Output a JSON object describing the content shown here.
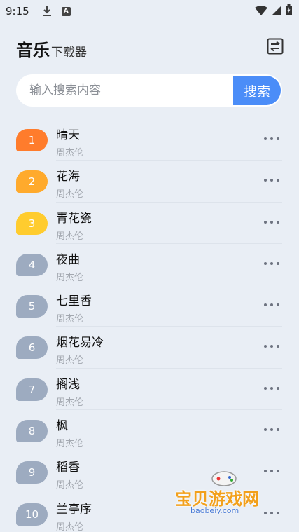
{
  "status_bar": {
    "time": "9:15",
    "a_label": "A"
  },
  "header": {
    "title": "音乐",
    "subtitle": "下载器"
  },
  "search": {
    "placeholder": "输入搜索内容",
    "button_label": "搜索",
    "button_color": "#4b8df8"
  },
  "songs": [
    {
      "rank": "1",
      "title": "晴天",
      "artist": "周杰伦",
      "badge_color": "#ff7c2c"
    },
    {
      "rank": "2",
      "title": "花海",
      "artist": "周杰伦",
      "badge_color": "#ffaa2c"
    },
    {
      "rank": "3",
      "title": "青花瓷",
      "artist": "周杰伦",
      "badge_color": "#ffcc2e"
    },
    {
      "rank": "4",
      "title": "夜曲",
      "artist": "周杰伦",
      "badge_color": "#9dabc0"
    },
    {
      "rank": "5",
      "title": "七里香",
      "artist": "周杰伦",
      "badge_color": "#9dabc0"
    },
    {
      "rank": "6",
      "title": "烟花易冷",
      "artist": "周杰伦",
      "badge_color": "#9dabc0"
    },
    {
      "rank": "7",
      "title": "搁浅",
      "artist": "周杰伦",
      "badge_color": "#9dabc0"
    },
    {
      "rank": "8",
      "title": "枫",
      "artist": "周杰伦",
      "badge_color": "#9dabc0"
    },
    {
      "rank": "9",
      "title": "稻香",
      "artist": "周杰伦",
      "badge_color": "#9dabc0"
    },
    {
      "rank": "10",
      "title": "兰亭序",
      "artist": "周杰伦",
      "badge_color": "#9dabc0"
    }
  ],
  "watermark": {
    "text": "宝贝游戏网",
    "url": "baobeiy.com"
  }
}
